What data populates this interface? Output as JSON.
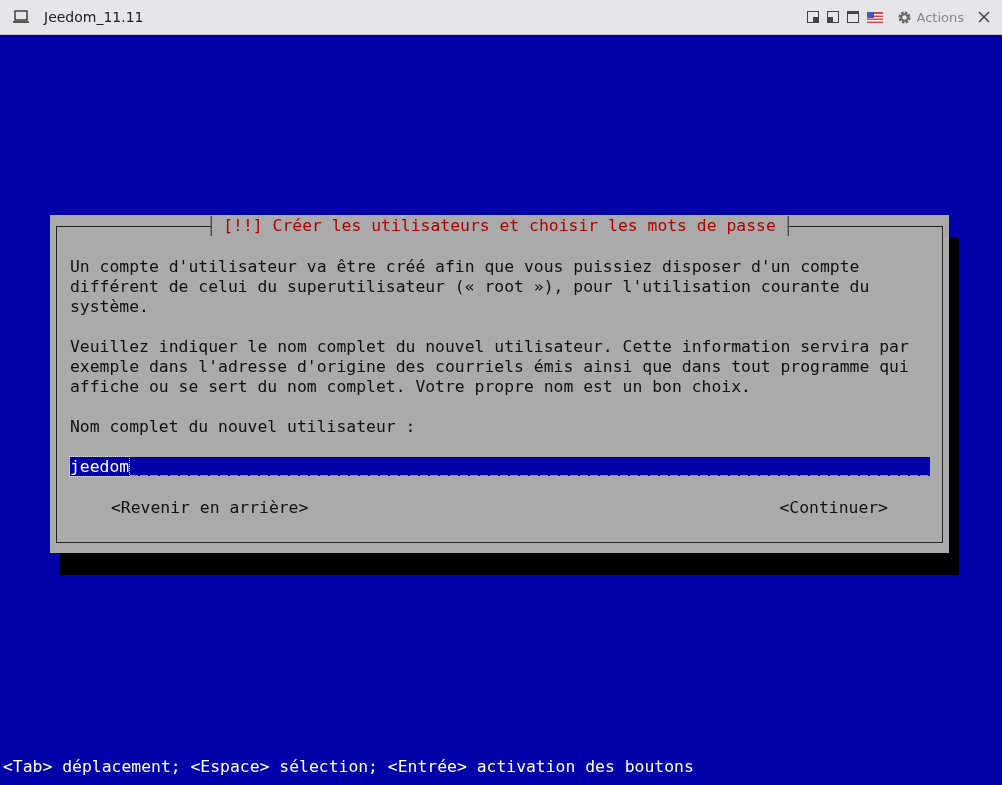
{
  "window": {
    "title": "Jeedom_11.11",
    "actions": "Actions"
  },
  "dialog": {
    "title": "[!!] Créer les utilisateurs et choisir les mots de passe",
    "paragraphs": [
      "Un compte d'utilisateur va être créé afin que vous puissiez disposer d'un compte\ndifférent de celui du superutilisateur (« root »), pour l'utilisation courante du\nsystème.",
      "Veuillez indiquer le nom complet du nouvel utilisateur. Cette information servira par\nexemple dans l'adresse d'origine des courriels émis ainsi que dans tout programme qui\naffiche ou se sert du nom complet. Votre propre nom est un bon choix."
    ],
    "field": {
      "label": "Nom complet du nouvel utilisateur :",
      "value": "jeedom"
    },
    "buttons": [
      "<Revenir en arrière>",
      "<Continuer>"
    ]
  },
  "status_bar": "<Tab> déplacement; <Espace> sélection; <Entrée> activation des boutons"
}
